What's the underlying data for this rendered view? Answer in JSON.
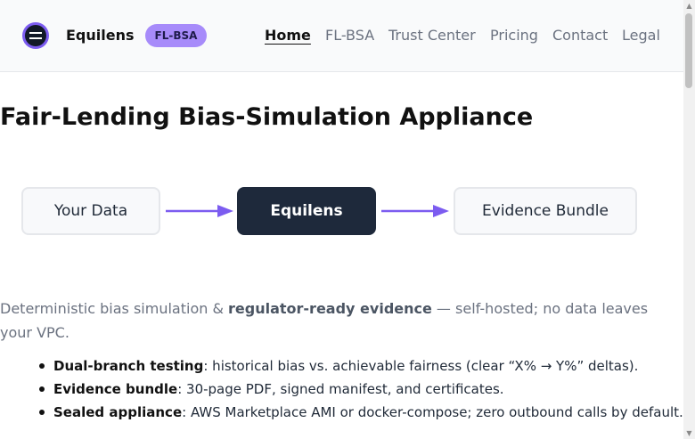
{
  "header": {
    "brand": "Equilens",
    "badge": "FL-BSA",
    "nav": [
      {
        "label": "Home",
        "active": true
      },
      {
        "label": "FL-BSA",
        "active": false
      },
      {
        "label": "Trust Center",
        "active": false
      },
      {
        "label": "Pricing",
        "active": false
      },
      {
        "label": "Contact",
        "active": false
      },
      {
        "label": "Legal",
        "active": false
      }
    ]
  },
  "main": {
    "title": "Fair-Lending Bias-Simulation Appliance",
    "flow": {
      "steps": [
        "Your Data",
        "Equilens",
        "Evidence Bundle"
      ]
    },
    "lead": {
      "part1": "Deterministic bias simulation & ",
      "strong": "regulator-ready evidence",
      "part2": " — self-hosted; no data leaves your VPC."
    },
    "features": [
      {
        "label": "Dual-branch testing",
        "text": ": historical bias vs. achievable fairness (clear “X% → Y%” deltas)."
      },
      {
        "label": "Evidence bundle",
        "text": ": 30-page PDF, signed manifest, and certificates."
      },
      {
        "label": "Sealed appliance",
        "text": ": AWS Marketplace AMI or docker-compose; zero outbound calls by default."
      }
    ]
  },
  "colors": {
    "accent": "#7c5cf0",
    "badge_bg": "#a78bfa",
    "dark_box": "#1e293b"
  },
  "icons": {
    "logo": "equilens-logo-icon",
    "arrows": "arrow-right-icon",
    "scroll_up": "chevron-up-icon",
    "scroll_down": "chevron-down-icon"
  }
}
